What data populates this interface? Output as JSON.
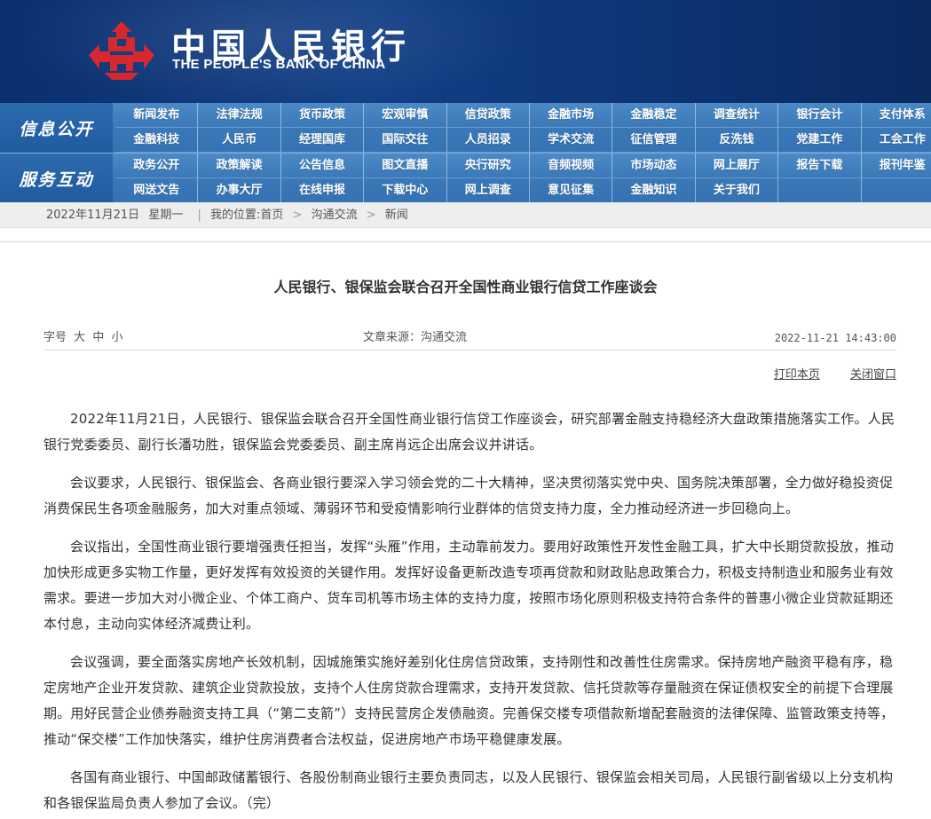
{
  "header": {
    "name_cn": "中国人民银行",
    "name_en": "THE PEOPLE'S BANK OF CHINA"
  },
  "nav": {
    "row1": {
      "label": "信息公开",
      "items": [
        "新闻发布",
        "法律法规",
        "货币政策",
        "宏观审慎",
        "信贷政策",
        "金融市场",
        "金融稳定",
        "调查统计",
        "银行会计",
        "支付体系",
        "金融科技",
        "人民币",
        "经理国库",
        "国际交往",
        "人员招录",
        "学术交流",
        "征信管理",
        "反洗钱",
        "党建工作",
        "工会工作"
      ]
    },
    "row2": {
      "label": "服务互动",
      "items": [
        "政务公开",
        "政策解读",
        "公告信息",
        "图文直播",
        "央行研究",
        "音频视频",
        "市场动态",
        "网上展厅",
        "报告下载",
        "报刊年鉴",
        "网送文告",
        "办事大厅",
        "在线申报",
        "下载中心",
        "网上调查",
        "意见征集",
        "金融知识",
        "关于我们",
        "",
        ""
      ]
    }
  },
  "breadcrumb": {
    "date": "2022年11月21日",
    "weekday": "星期一",
    "location_label": "我的位置:",
    "home": "首页",
    "level1": "沟通交流",
    "level2": "新闻",
    "separator": ">"
  },
  "article": {
    "title": "人民银行、银保监会联合召开全国性商业银行信贷工作座谈会",
    "font_size_label": "字号",
    "font_large": "大",
    "font_medium": "中",
    "font_small": "小",
    "source": "文章来源：沟通交流",
    "datetime": "2022-11-21 14:43:00",
    "print_label": "打印本页",
    "close_label": "关闭窗口",
    "paragraphs": [
      "2022年11月21日，人民银行、银保监会联合召开全国性商业银行信贷工作座谈会，研究部署金融支持稳经济大盘政策措施落实工作。人民银行党委委员、副行长潘功胜，银保监会党委委员、副主席肖远企出席会议并讲话。",
      "会议要求，人民银行、银保监会、各商业银行要深入学习领会党的二十大精神，坚决贯彻落实党中央、国务院决策部署，全力做好稳投资促消费保民生各项金融服务，加大对重点领域、薄弱环节和受疫情影响行业群体的信贷支持力度，全力推动经济进一步回稳向上。",
      "会议指出，全国性商业银行要增强责任担当，发挥“头雁”作用，主动靠前发力。要用好政策性开发性金融工具，扩大中长期贷款投放，推动加快形成更多实物工作量，更好发挥有效投资的关键作用。发挥好设备更新改造专项再贷款和财政贴息政策合力，积极支持制造业和服务业有效需求。要进一步加大对小微企业、个体工商户、货车司机等市场主体的支持力度，按照市场化原则积极支持符合条件的普惠小微企业贷款延期还本付息，主动向实体经济减费让利。",
      "会议强调，要全面落实房地产长效机制，因城施策实施好差别化住房信贷政策，支持刚性和改善性住房需求。保持房地产融资平稳有序，稳定房地产企业开发贷款、建筑企业贷款投放，支持个人住房贷款合理需求，支持开发贷款、信托贷款等存量融资在保证债权安全的前提下合理展期。用好民营企业债券融资支持工具（“第二支箭”）支持民营房企发债融资。完善保交楼专项借款新增配套融资的法律保障、监管政策支持等，推动“保交楼”工作加快落实，维护住房消费者合法权益，促进房地产市场平稳健康发展。",
      "各国有商业银行、中国邮政储蓄银行、各股份制商业银行主要负责同志，以及人民银行、银保监会相关司局，人民银行副省级以上分支机构和各银保监局负责人参加了会议。（完）"
    ]
  },
  "colors": {
    "header_bg": "#0f3a7e",
    "nav_bg": "#3a78b8",
    "emblem_red": "#d7282f"
  }
}
